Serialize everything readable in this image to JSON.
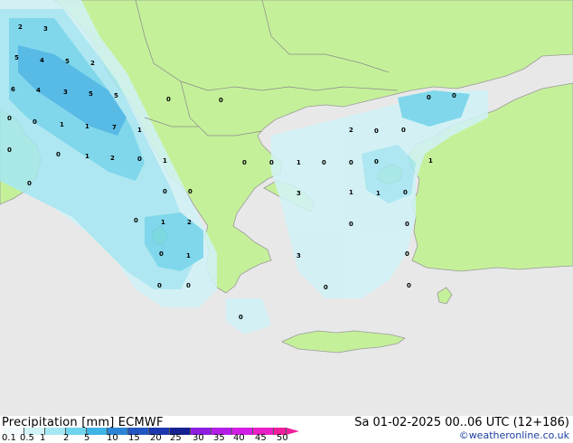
{
  "legend": {
    "title": "Precipitation [mm]  ECMWF",
    "date": "Sa 01-02-2025 00..06 UTC (12+186)",
    "credit": "©weatheronline.co.uk",
    "scale": [
      {
        "label": "0.1",
        "color": "#f2fbfd"
      },
      {
        "label": "0.5",
        "color": "#d0f3f8"
      },
      {
        "label": "1",
        "color": "#a5e7f3"
      },
      {
        "label": "2",
        "color": "#6fd5ec"
      },
      {
        "label": "5",
        "color": "#3fb4e6"
      },
      {
        "label": "10",
        "color": "#2a85d6"
      },
      {
        "label": "15",
        "color": "#2255c2"
      },
      {
        "label": "20",
        "color": "#1c37ad"
      },
      {
        "label": "25",
        "color": "#152190"
      },
      {
        "label": "30",
        "color": "#8d1ee0"
      },
      {
        "label": "35",
        "color": "#b31ee6"
      },
      {
        "label": "40",
        "color": "#d21ee4"
      },
      {
        "label": "45",
        "color": "#e91ec8"
      },
      {
        "label": "50",
        "color": "#f01e9e"
      }
    ]
  },
  "colors": {
    "sea": "#e8e8e8",
    "land": "#c5f09a",
    "coast": "#9a9a9a",
    "border": "#8a8a8a"
  },
  "values": [
    "2",
    "3",
    "5",
    "4",
    "5",
    "2",
    "6",
    "4",
    "3",
    "5",
    "5",
    "0",
    "1",
    "1",
    "7",
    "1",
    "0",
    "0",
    "0",
    "1",
    "2",
    "0",
    "1",
    "0",
    "0",
    "0",
    "1",
    "0",
    "0",
    "0",
    "0",
    "0",
    "1",
    "2",
    "0",
    "1",
    "0",
    "0",
    "2",
    "0",
    "0",
    "3",
    "1",
    "1",
    "0",
    "0",
    "0",
    "3",
    "0",
    "0",
    "0",
    "0",
    "0",
    "0",
    "1",
    "0",
    "0",
    "0"
  ]
}
